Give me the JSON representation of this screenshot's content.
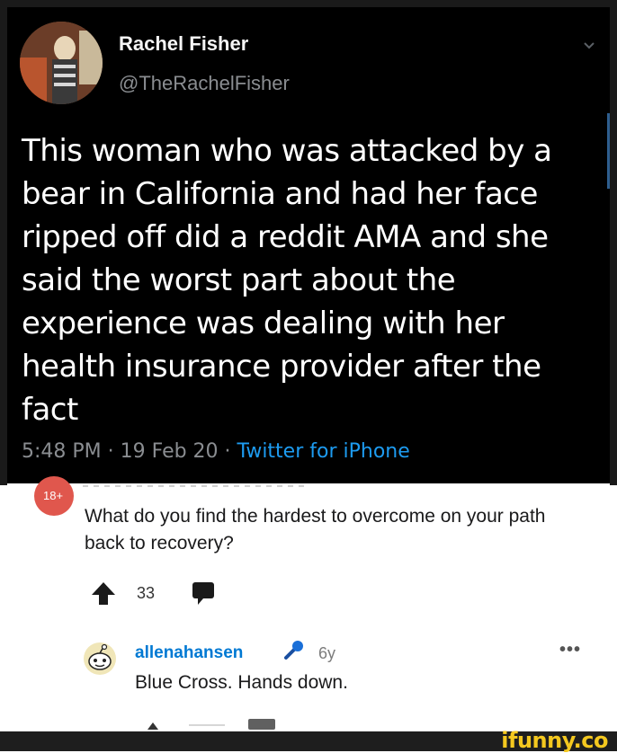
{
  "tweet": {
    "author_name": "Rachel Fisher",
    "author_handle": "@TheRachelFisher",
    "text": "This woman who was attacked by a bear in California and had her face ripped off did a reddit AMA and she said the worst part about the experience was dealing with her health insurance provider after the fact",
    "timestamp": "5:48 PM · 19 Feb 20 · ",
    "source": "Twitter for iPhone",
    "colors": {
      "background": "#000000",
      "text": "#ffffff",
      "muted": "#8a8d91",
      "link": "#1d9bf0"
    }
  },
  "reddit": {
    "badge": "18+",
    "question": "What do you find the hardest to overcome on your path back to recovery?",
    "score": "33",
    "reply": {
      "username": "allenahansen",
      "age": "6y",
      "text": "Blue Cross. Hands down.",
      "more": "•••"
    },
    "colors": {
      "username": "#0079d3",
      "badge": "#e0574d"
    }
  },
  "watermark": {
    "label": "ifunny.co",
    "color": "#f4c81f"
  },
  "icons": [
    "chevron-down-icon",
    "upvote-arrow-icon",
    "comment-icon",
    "snoo-avatar-icon",
    "microphone-icon",
    "more-options-icon"
  ]
}
